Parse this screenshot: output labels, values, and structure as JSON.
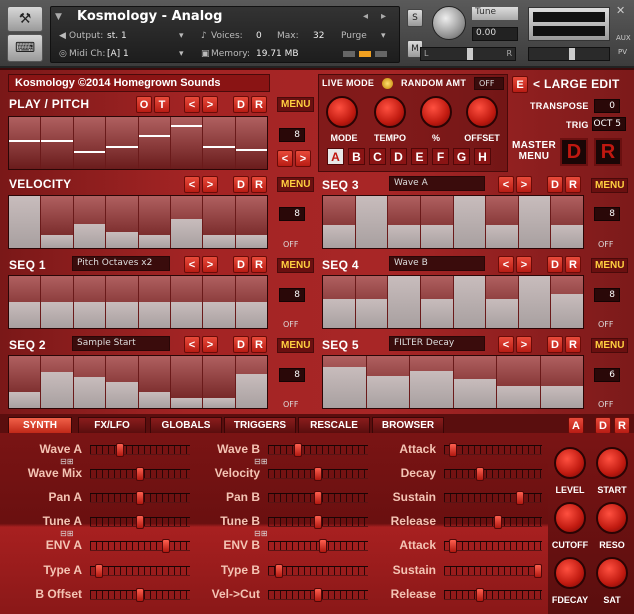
{
  "header": {
    "title": "Kosmology - Analog",
    "output_label": "Output:",
    "output_value": "st. 1",
    "midi_label": "Midi Ch:",
    "midi_value": "[A] 1",
    "voices_label": "Voices:",
    "voices_value": "0",
    "max_label": "Max:",
    "max_value": "32",
    "memory_label": "Memory:",
    "memory_value": "19.71 MB",
    "purge_label": "Purge",
    "s_label": "S",
    "m_label": "M",
    "tune_label": "Tune",
    "tune_value": "0.00",
    "aux_label": "AUX",
    "pv_label": "PV",
    "l_label": "L",
    "r_label": "R",
    "close_icon": "✕",
    "nav_prev": "◂",
    "nav_next": "▸"
  },
  "credit": "Kosmology ©2014 Homegrown Sounds",
  "live": {
    "live_mode": "LIVE MODE",
    "random_amt": "RANDOM AMT",
    "random_value": "OFF",
    "e_label": "E",
    "large_edit": "< LARGE EDIT",
    "transpose_label": "TRANSPOSE",
    "transpose_value": "0",
    "trig_label": "TRIG",
    "trig_value": "OCT 5",
    "master_menu": "MASTER MENU",
    "d_label": "D",
    "r_label": "R",
    "knobs": [
      "MODE",
      "TEMPO",
      "%",
      "OFFSET"
    ],
    "letters": [
      "A",
      "B",
      "C",
      "D",
      "E",
      "F",
      "G",
      "H"
    ]
  },
  "common": {
    "lt": "<",
    "gt": ">",
    "d": "D",
    "r": "R",
    "menu": "MENU",
    "off": "OFF"
  },
  "play": {
    "title": "PLAY / PITCH",
    "o": "O",
    "t": "T",
    "steps": "8",
    "values": [
      0.55,
      0.55,
      0.35,
      0.45,
      0.65,
      0.85,
      0.45,
      0.38
    ]
  },
  "velocity": {
    "title": "VELOCITY",
    "steps": "8",
    "values": [
      1.0,
      0.25,
      0.47,
      0.3,
      0.25,
      0.55,
      0.25,
      0.25
    ]
  },
  "seq1": {
    "title": "SEQ 1",
    "lcd": "Pitch Octaves x2",
    "steps": "8",
    "values": [
      0.5,
      0.5,
      0.5,
      0.5,
      0.5,
      0.5,
      0.5,
      0.5
    ]
  },
  "seq2": {
    "title": "SEQ 2",
    "lcd": "Sample Start",
    "steps": "8",
    "values": [
      0.3,
      0.7,
      0.6,
      0.5,
      0.3,
      0.2,
      0.2,
      0.65
    ]
  },
  "seq3": {
    "title": "SEQ 3",
    "lcd": "Wave A",
    "steps": "8",
    "values": [
      0.45,
      1.0,
      0.45,
      0.45,
      1.0,
      0.45,
      1.0,
      0.45
    ]
  },
  "seq4": {
    "title": "SEQ 4",
    "lcd": "Wave B",
    "steps": "8",
    "values": [
      0.55,
      0.55,
      1.0,
      0.55,
      1.0,
      0.55,
      1.0,
      0.65
    ]
  },
  "seq5": {
    "title": "SEQ 5",
    "lcd": "FILTER Decay",
    "steps": "6",
    "values": [
      0.78,
      0.62,
      0.72,
      0.55,
      0.42,
      0.42
    ]
  },
  "tabs": [
    "SYNTH",
    "FX/LFO",
    "GLOBALS",
    "TRIGGERS",
    "RESCALE",
    "BROWSER"
  ],
  "tab_buttons": {
    "a": "A",
    "d": "D",
    "r": "R"
  },
  "synth": {
    "col1": [
      {
        "label": "Wave A",
        "pos": 0.28
      },
      {
        "label": "Wave Mix",
        "pos": 0.5
      },
      {
        "label": "Pan A",
        "pos": 0.5
      },
      {
        "label": "Tune A",
        "pos": 0.5
      },
      {
        "label": "ENV A",
        "pos": 0.78
      },
      {
        "label": "Type A",
        "pos": 0.05
      },
      {
        "label": "B Offset",
        "pos": 0.5
      }
    ],
    "col2": [
      {
        "label": "Wave B",
        "pos": 0.28
      },
      {
        "label": "Velocity",
        "pos": 0.5
      },
      {
        "label": "Pan B",
        "pos": 0.5
      },
      {
        "label": "Tune B",
        "pos": 0.5
      },
      {
        "label": "ENV B",
        "pos": 0.55
      },
      {
        "label": "Type B",
        "pos": 0.08
      },
      {
        "label": "Vel->Cut",
        "pos": 0.5
      }
    ],
    "col3": [
      {
        "label": "Attack",
        "pos": 0.05
      },
      {
        "label": "Decay",
        "pos": 0.35
      },
      {
        "label": "Sustain",
        "pos": 0.8
      },
      {
        "label": "Release",
        "pos": 0.55
      },
      {
        "label": "Attack",
        "pos": 0.05
      },
      {
        "label": "Sustain",
        "pos": 1.0
      },
      {
        "label": "Release",
        "pos": 0.35
      }
    ],
    "knobs": [
      "LEVEL",
      "START",
      "CUTOFF",
      "RESO",
      "FDECAY",
      "SAT"
    ]
  }
}
